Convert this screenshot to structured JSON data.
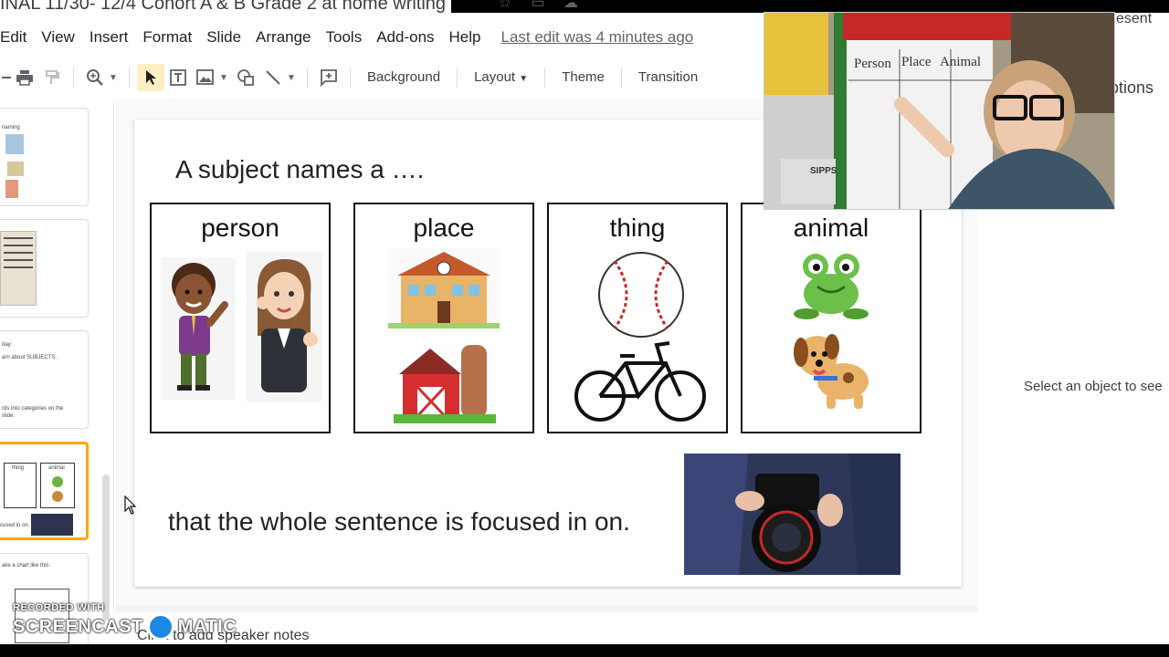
{
  "header": {
    "doc_title": "INAL 11/30- 12/4 Cohort A & B Grade 2 at home writing",
    "present_label": "esent",
    "options_label": "ptions"
  },
  "menu": {
    "items": [
      "Edit",
      "View",
      "Insert",
      "Format",
      "Slide",
      "Arrange",
      "Tools",
      "Add-ons",
      "Help"
    ],
    "last_edit": "Last edit was 4 minutes ago"
  },
  "toolbar": {
    "background": "Background",
    "layout": "Layout",
    "theme": "Theme",
    "transition": "Transition"
  },
  "filmstrip": {
    "thumb1_text": "naming",
    "thumb3_text1": "day:",
    "thumb3_text2": "arn about SUBJECTS.",
    "thumb3_text3": "rds into categories on the",
    "thumb3_text4": "slide.",
    "thumb4_label1": "thing",
    "thumb4_label2": "animal",
    "thumb4_text": "cused in on.",
    "thumb5_text": "ake a chart like this:"
  },
  "slide": {
    "heading": "A subject names a ….",
    "cards": [
      "person",
      "place",
      "thing",
      "animal"
    ],
    "footer": "that the whole sentence is focused in on."
  },
  "notes": {
    "placeholder": "Click to add speaker notes"
  },
  "side_panel": {
    "message": "Select an object to see"
  },
  "webcam": {
    "chart_headers": [
      "Person",
      "Place",
      "Animal"
    ],
    "book_label": "SIPPS"
  },
  "watermark": {
    "line1": "RECORDED WITH",
    "line2": "SCREENCAST",
    "line3": "MATIC"
  },
  "colors": {
    "accent_selected": "#f9ab00",
    "toolbar_active": "#feefc3",
    "link_gray": "#5f6368"
  }
}
